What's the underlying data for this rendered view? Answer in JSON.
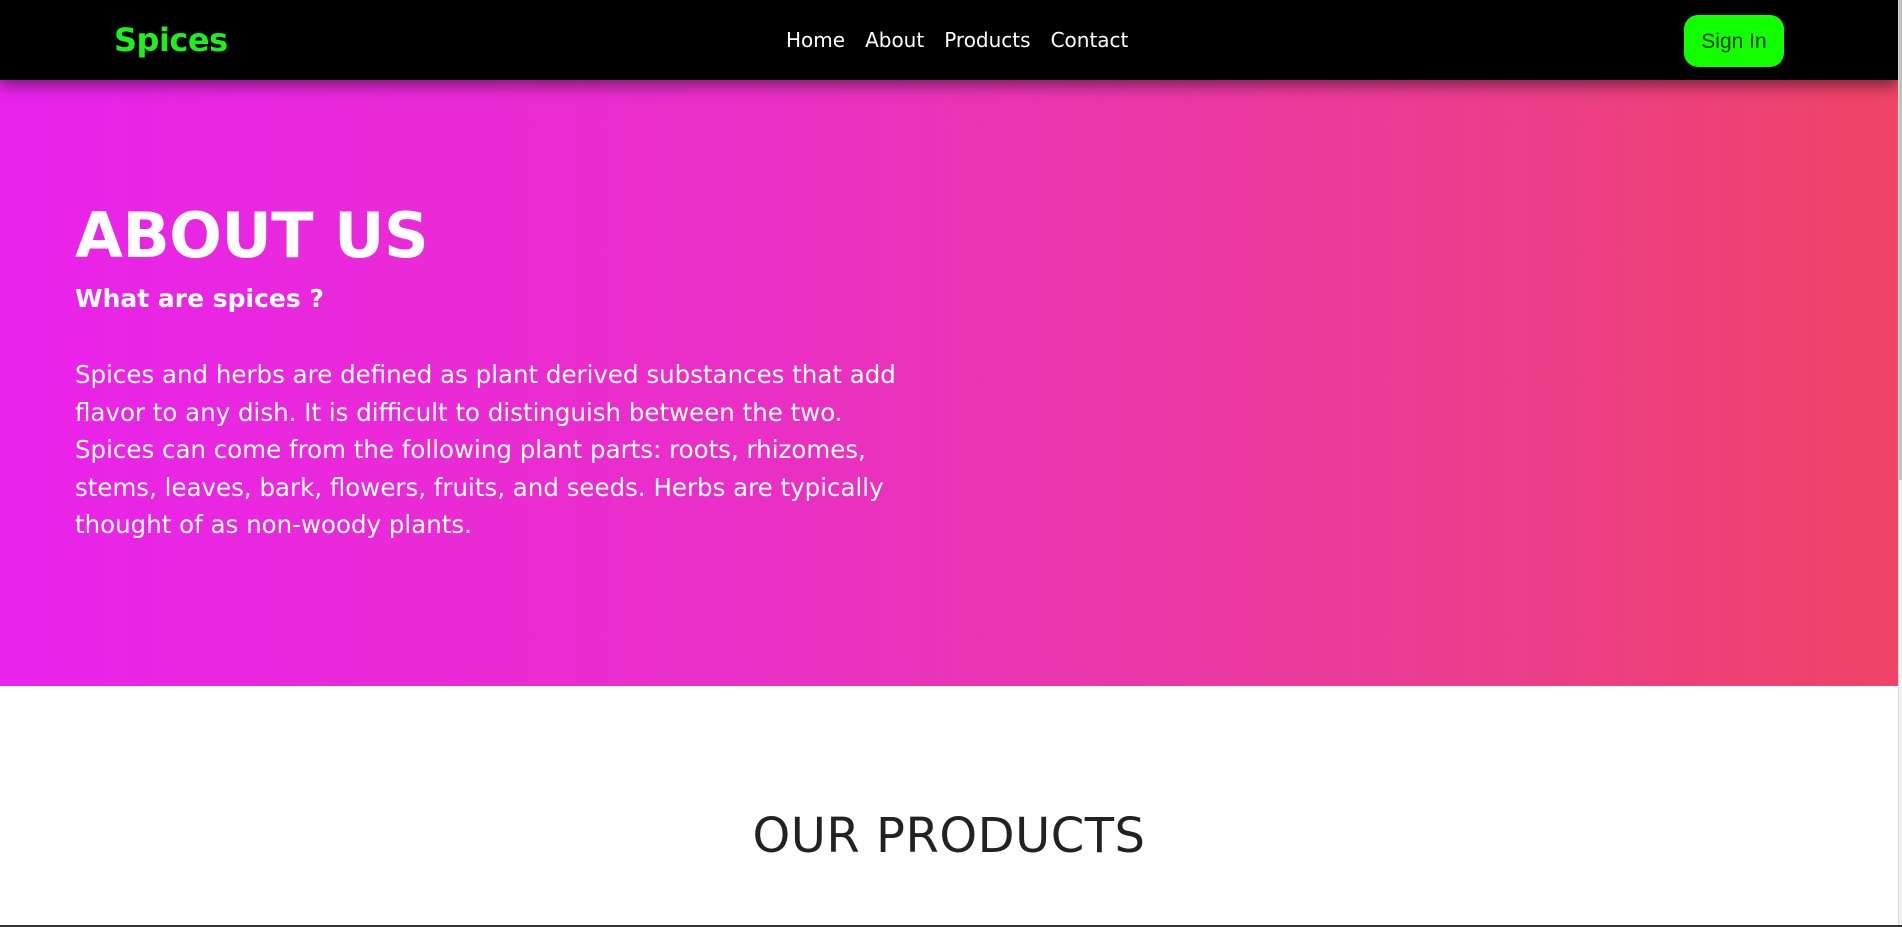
{
  "navbar": {
    "brand": "Spices",
    "links": [
      "Home",
      "About",
      "Products",
      "Contact"
    ],
    "signin_label": "Sign In"
  },
  "hero": {
    "title": "ABOUT US",
    "subtitle": "What are spices ?",
    "paragraph": "Spices and herbs are defined as plant derived substances that add flavor to any dish. It is difficult to distinguish between the two. Spices can come from the following plant parts: roots, rhizomes, stems, leaves, bark, flowers, fruits, and seeds. Herbs are typically thought of as non-woody plants."
  },
  "products": {
    "title": "OUR PRODUCTS"
  },
  "colors": {
    "navbar_bg": "#000000",
    "brand_color": "#1ef01e",
    "signin_bg": "#11ff00",
    "hero_gradient_start": "#e923ec",
    "hero_gradient_end": "#ee4466",
    "page_bg": "#ffffff"
  }
}
